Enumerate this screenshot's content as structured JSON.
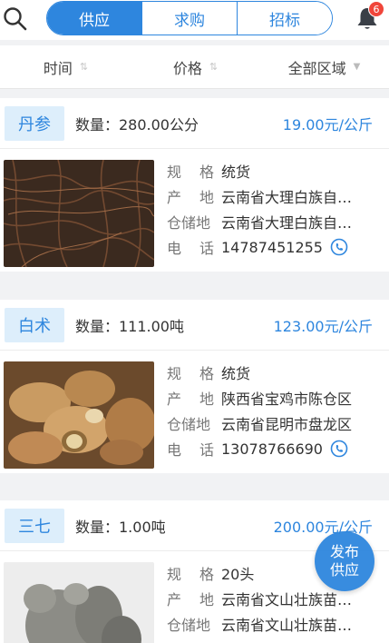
{
  "header": {
    "tabs": [
      {
        "label": "供应",
        "active": true
      },
      {
        "label": "求购",
        "active": false
      },
      {
        "label": "招标",
        "active": false
      }
    ],
    "notification_count": "6",
    "search_icon": "search-icon",
    "bell_icon": "bell-icon"
  },
  "filters": [
    {
      "label": "时间",
      "indicator": "sort-icon"
    },
    {
      "label": "价格",
      "indicator": "sort-icon"
    },
    {
      "label": "全部区域",
      "indicator": "caret-down-icon"
    }
  ],
  "listings": [
    {
      "name": "丹参",
      "quantity": "数量：280.00公分",
      "price": "19.00元/公斤",
      "spec_label": "规格",
      "spec": "统货",
      "origin_label": "产地",
      "origin": "云南省大理白族自…",
      "storage_label": "仓储地",
      "storage": "云南省大理白族自…",
      "phone_label": "电话",
      "phone": "14787451255",
      "image": "dried danshen roots"
    },
    {
      "name": "白术",
      "quantity": "数量：111.00吨",
      "price": "123.00元/公斤",
      "spec_label": "规格",
      "spec": "统货",
      "origin_label": "产地",
      "origin": "陕西省宝鸡市陈仓区",
      "storage_label": "仓储地",
      "storage": "云南省昆明市盘龙区",
      "phone_label": "电话",
      "phone": "13078766690",
      "image": "baizhu rhizome slices"
    },
    {
      "name": "三七",
      "quantity": "数量：1.00吨",
      "price": "200.00元/公斤",
      "spec_label": "规格",
      "spec": "20头",
      "origin_label": "产地",
      "origin": "云南省文山壮族苗…",
      "storage_label": "仓储地",
      "storage": "云南省文山壮族苗…",
      "image": "sanqi roots"
    }
  ],
  "fab": {
    "line1": "发布",
    "line2": "供应"
  },
  "colors": {
    "accent": "#2e86de",
    "badge": "#f0453a",
    "chip_bg": "#ddeefb"
  }
}
